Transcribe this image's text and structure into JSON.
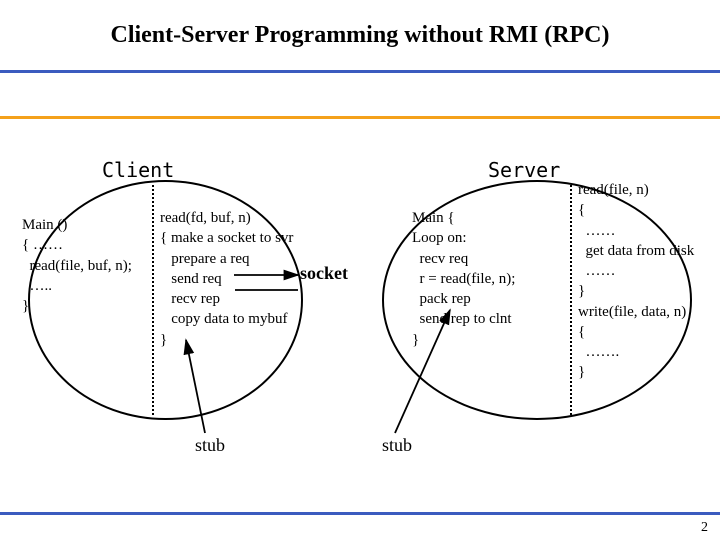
{
  "title": "Client-Server Programming without RMI (RPC)",
  "labels": {
    "client": "Client",
    "server": "Server",
    "socket": "socket",
    "stub1": "stub",
    "stub2": "stub"
  },
  "code": {
    "client_main": "Main ()\n{ ……\n  read(file, buf, n);\n  …..\n}",
    "client_stub": "read(fd, buf, n)\n{ make a socket to svr\n   prepare a req\n   send req\n   recv rep\n   copy data to mybuf\n}",
    "server_main": "Main {\nLoop on:\n  recv req\n  r = read(file, n);\n  pack rep\n  send rep to clnt\n}",
    "server_read": "read(file, n)\n{\n  ……\n  get data from disk\n  ……\n}\nwrite(file, data, n)\n{\n  …….\n}"
  },
  "page": "2"
}
